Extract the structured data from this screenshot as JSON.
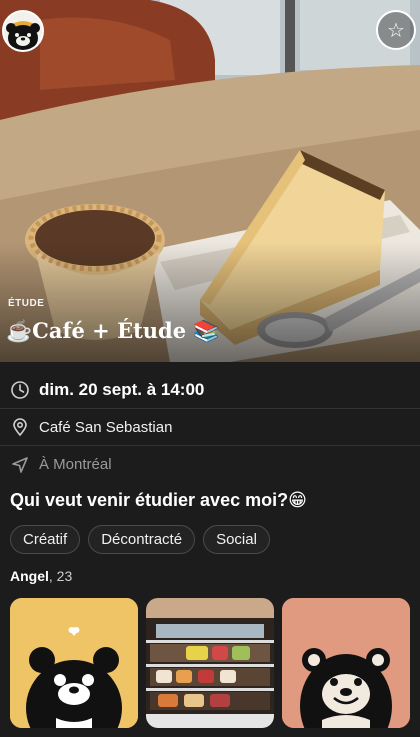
{
  "hero": {
    "category": "ÉTUDE",
    "title": "☕Café + Étude 📚",
    "avatar_icon": "bear-icon",
    "favorite_icon": "star-outline-icon"
  },
  "details": {
    "date": "dim. 20 sept. à 14:00",
    "place": "Café San Sebastian",
    "city": "À Montréal"
  },
  "question": "Qui veut venir étudier avec moi?😁",
  "tags": [
    "Créatif",
    "Décontracté",
    "Social"
  ],
  "user": {
    "name": "Angel",
    "age": ", 23"
  },
  "colors": {
    "background": "#1c1c1c",
    "card_yellow": "#efc466",
    "card_salmon": "#df9a7f"
  }
}
